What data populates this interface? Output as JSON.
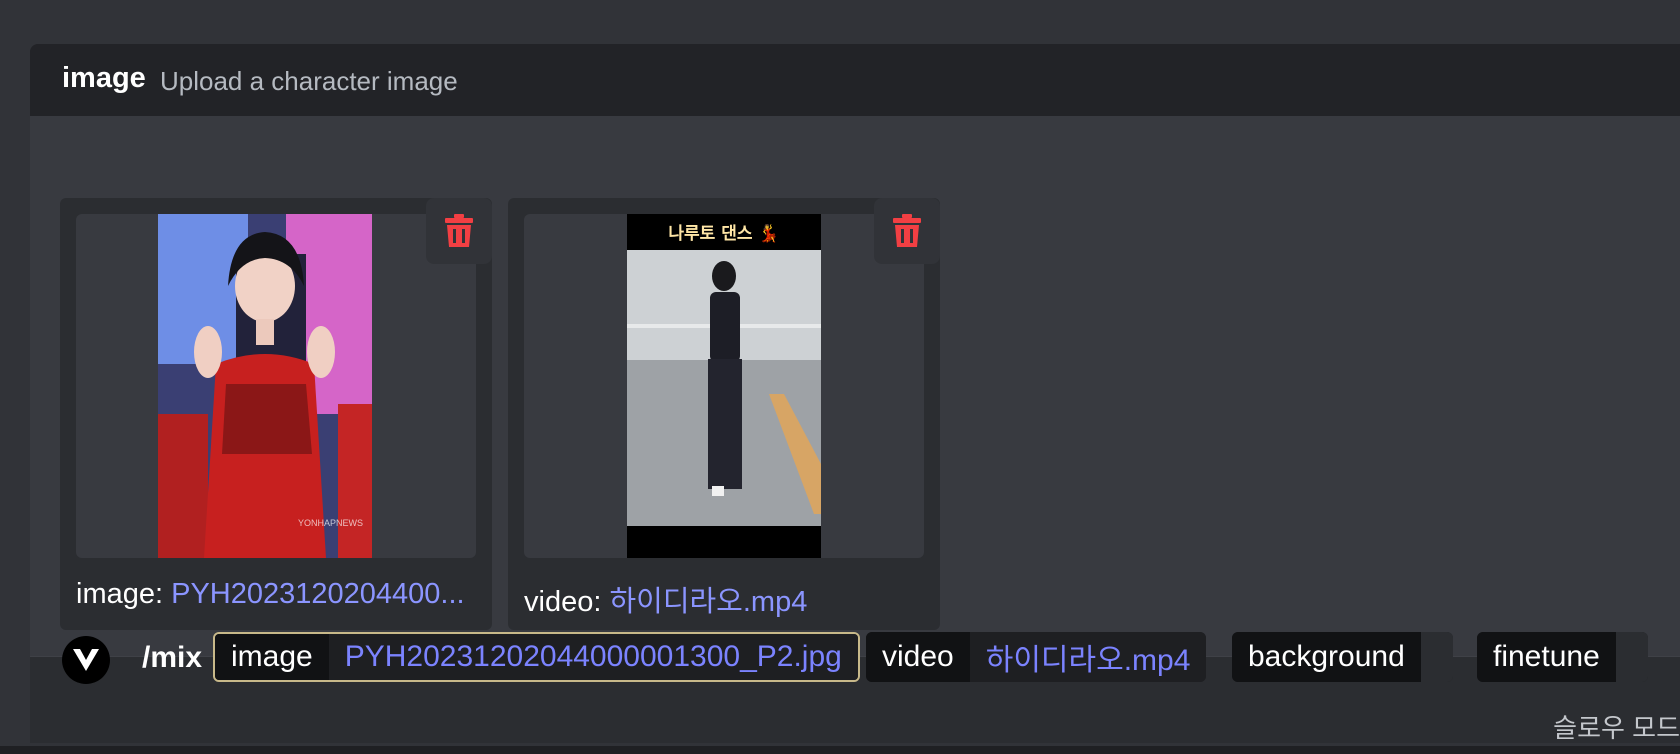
{
  "option": {
    "name": "image",
    "description": "Upload a character image"
  },
  "attachments": [
    {
      "type_label": "image: ",
      "filename": "PYH2023120204400...",
      "delete_icon": "trash-icon"
    },
    {
      "type_label": "video: ",
      "filename": "하이디라오.mp4",
      "delete_icon": "trash-icon",
      "overlay_text": "나루토 댄스 💃"
    }
  ],
  "command": {
    "name": "/mix",
    "params": [
      {
        "key": "image",
        "value": "PYH20231202044000001300_P2.jpg"
      },
      {
        "key": "video",
        "value": "하이디라오.mp4"
      },
      {
        "key": "background",
        "value": ""
      },
      {
        "key": "finetune",
        "value": ""
      }
    ]
  },
  "mode_text": "슬로우 모드"
}
